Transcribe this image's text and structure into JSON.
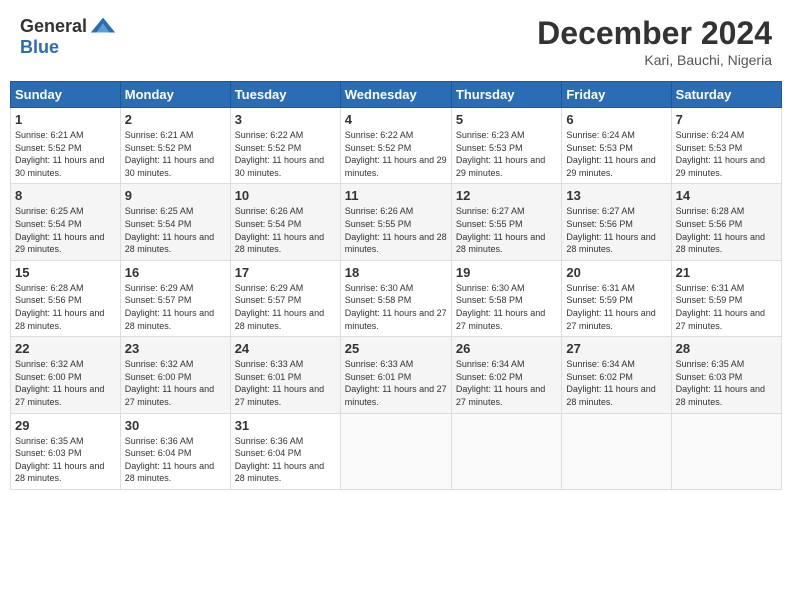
{
  "header": {
    "logo": {
      "general": "General",
      "blue": "Blue"
    },
    "title": "December 2024",
    "location": "Kari, Bauchi, Nigeria"
  },
  "days_of_week": [
    "Sunday",
    "Monday",
    "Tuesday",
    "Wednesday",
    "Thursday",
    "Friday",
    "Saturday"
  ],
  "weeks": [
    [
      {
        "day": "1",
        "sunrise": "6:21 AM",
        "sunset": "5:52 PM",
        "daylight": "11 hours and 30 minutes."
      },
      {
        "day": "2",
        "sunrise": "6:21 AM",
        "sunset": "5:52 PM",
        "daylight": "11 hours and 30 minutes."
      },
      {
        "day": "3",
        "sunrise": "6:22 AM",
        "sunset": "5:52 PM",
        "daylight": "11 hours and 30 minutes."
      },
      {
        "day": "4",
        "sunrise": "6:22 AM",
        "sunset": "5:52 PM",
        "daylight": "11 hours and 29 minutes."
      },
      {
        "day": "5",
        "sunrise": "6:23 AM",
        "sunset": "5:53 PM",
        "daylight": "11 hours and 29 minutes."
      },
      {
        "day": "6",
        "sunrise": "6:24 AM",
        "sunset": "5:53 PM",
        "daylight": "11 hours and 29 minutes."
      },
      {
        "day": "7",
        "sunrise": "6:24 AM",
        "sunset": "5:53 PM",
        "daylight": "11 hours and 29 minutes."
      }
    ],
    [
      {
        "day": "8",
        "sunrise": "6:25 AM",
        "sunset": "5:54 PM",
        "daylight": "11 hours and 29 minutes."
      },
      {
        "day": "9",
        "sunrise": "6:25 AM",
        "sunset": "5:54 PM",
        "daylight": "11 hours and 28 minutes."
      },
      {
        "day": "10",
        "sunrise": "6:26 AM",
        "sunset": "5:54 PM",
        "daylight": "11 hours and 28 minutes."
      },
      {
        "day": "11",
        "sunrise": "6:26 AM",
        "sunset": "5:55 PM",
        "daylight": "11 hours and 28 minutes."
      },
      {
        "day": "12",
        "sunrise": "6:27 AM",
        "sunset": "5:55 PM",
        "daylight": "11 hours and 28 minutes."
      },
      {
        "day": "13",
        "sunrise": "6:27 AM",
        "sunset": "5:56 PM",
        "daylight": "11 hours and 28 minutes."
      },
      {
        "day": "14",
        "sunrise": "6:28 AM",
        "sunset": "5:56 PM",
        "daylight": "11 hours and 28 minutes."
      }
    ],
    [
      {
        "day": "15",
        "sunrise": "6:28 AM",
        "sunset": "5:56 PM",
        "daylight": "11 hours and 28 minutes."
      },
      {
        "day": "16",
        "sunrise": "6:29 AM",
        "sunset": "5:57 PM",
        "daylight": "11 hours and 28 minutes."
      },
      {
        "day": "17",
        "sunrise": "6:29 AM",
        "sunset": "5:57 PM",
        "daylight": "11 hours and 28 minutes."
      },
      {
        "day": "18",
        "sunrise": "6:30 AM",
        "sunset": "5:58 PM",
        "daylight": "11 hours and 27 minutes."
      },
      {
        "day": "19",
        "sunrise": "6:30 AM",
        "sunset": "5:58 PM",
        "daylight": "11 hours and 27 minutes."
      },
      {
        "day": "20",
        "sunrise": "6:31 AM",
        "sunset": "5:59 PM",
        "daylight": "11 hours and 27 minutes."
      },
      {
        "day": "21",
        "sunrise": "6:31 AM",
        "sunset": "5:59 PM",
        "daylight": "11 hours and 27 minutes."
      }
    ],
    [
      {
        "day": "22",
        "sunrise": "6:32 AM",
        "sunset": "6:00 PM",
        "daylight": "11 hours and 27 minutes."
      },
      {
        "day": "23",
        "sunrise": "6:32 AM",
        "sunset": "6:00 PM",
        "daylight": "11 hours and 27 minutes."
      },
      {
        "day": "24",
        "sunrise": "6:33 AM",
        "sunset": "6:01 PM",
        "daylight": "11 hours and 27 minutes."
      },
      {
        "day": "25",
        "sunrise": "6:33 AM",
        "sunset": "6:01 PM",
        "daylight": "11 hours and 27 minutes."
      },
      {
        "day": "26",
        "sunrise": "6:34 AM",
        "sunset": "6:02 PM",
        "daylight": "11 hours and 27 minutes."
      },
      {
        "day": "27",
        "sunrise": "6:34 AM",
        "sunset": "6:02 PM",
        "daylight": "11 hours and 28 minutes."
      },
      {
        "day": "28",
        "sunrise": "6:35 AM",
        "sunset": "6:03 PM",
        "daylight": "11 hours and 28 minutes."
      }
    ],
    [
      {
        "day": "29",
        "sunrise": "6:35 AM",
        "sunset": "6:03 PM",
        "daylight": "11 hours and 28 minutes."
      },
      {
        "day": "30",
        "sunrise": "6:36 AM",
        "sunset": "6:04 PM",
        "daylight": "11 hours and 28 minutes."
      },
      {
        "day": "31",
        "sunrise": "6:36 AM",
        "sunset": "6:04 PM",
        "daylight": "11 hours and 28 minutes."
      },
      null,
      null,
      null,
      null
    ]
  ]
}
